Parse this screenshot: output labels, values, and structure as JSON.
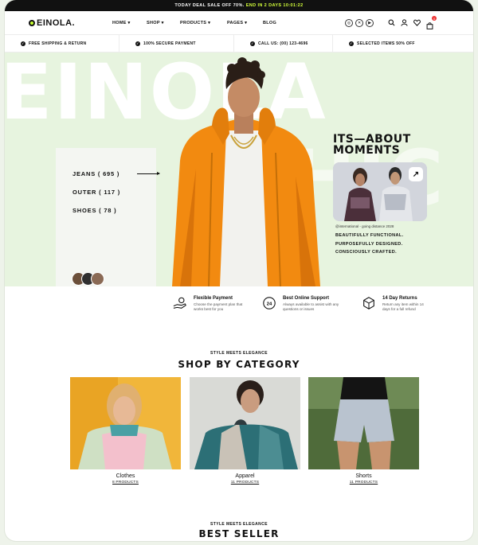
{
  "topbar": {
    "prefix": "TODAY DEAL SALE OFF 70%.",
    "highlight": "END IN 2 DAYS 10:01:22"
  },
  "header": {
    "logo": "EINOLA.",
    "nav": [
      "HOME",
      "SHOP",
      "PRODUCTS",
      "PAGES",
      "BLOG"
    ],
    "socials": [
      "instagram-icon",
      "x-icon",
      "youtube-icon"
    ],
    "cart_count": "0"
  },
  "strip": {
    "items": [
      "FREE SHIPPING & RETURN",
      "100% SECURE PAYMENT",
      "CALL US: (00) 123-4696",
      "SELECTED ITEMS 50% OFF"
    ]
  },
  "hero": {
    "bigword": "EINOLA",
    "bigword_right": "HIC",
    "categories": [
      "JEANS ( 695 )",
      "OUTER ( 117 )",
      "SHOES ( 78 )"
    ],
    "tagline": [
      "ITS—ABOUT",
      "MOMENTS"
    ],
    "caption": "@international - going distance 2028",
    "slogan": [
      "BEAUTIFULLY FUNCTIONAL.",
      "PURPOSEFULLY DESIGNED.",
      "CONSCIOUSLY CRAFTED."
    ]
  },
  "services": [
    {
      "title": "Flexible Payment",
      "desc": "Choose the payment plan that works best for you",
      "icon": "hand-money-icon"
    },
    {
      "title": "Best Online Support",
      "desc": "Always available to assist with any questions or issues",
      "icon": "support-24-icon"
    },
    {
      "title": "14 Day Returns",
      "desc": "Return any item within 14 days for a full refund",
      "icon": "return-box-icon"
    }
  ],
  "category_section": {
    "kicker": "STYLE MEETS ELEGANCE",
    "title": "SHOP BY CATEGORY",
    "cards": [
      {
        "name": "Clothes",
        "count": "8 PRODUCTS"
      },
      {
        "name": "Apparel",
        "count": "11 PRODUCTS"
      },
      {
        "name": "Shorts",
        "count": "11 PRODUCTS"
      }
    ]
  },
  "bestseller_section": {
    "kicker": "STYLE MEETS ELEGANCE",
    "title": "BEST SELLER"
  },
  "colors": {
    "accent": "#c6ff2e",
    "hero_bg": "#e7f4df",
    "jacket": "#f28a10"
  }
}
